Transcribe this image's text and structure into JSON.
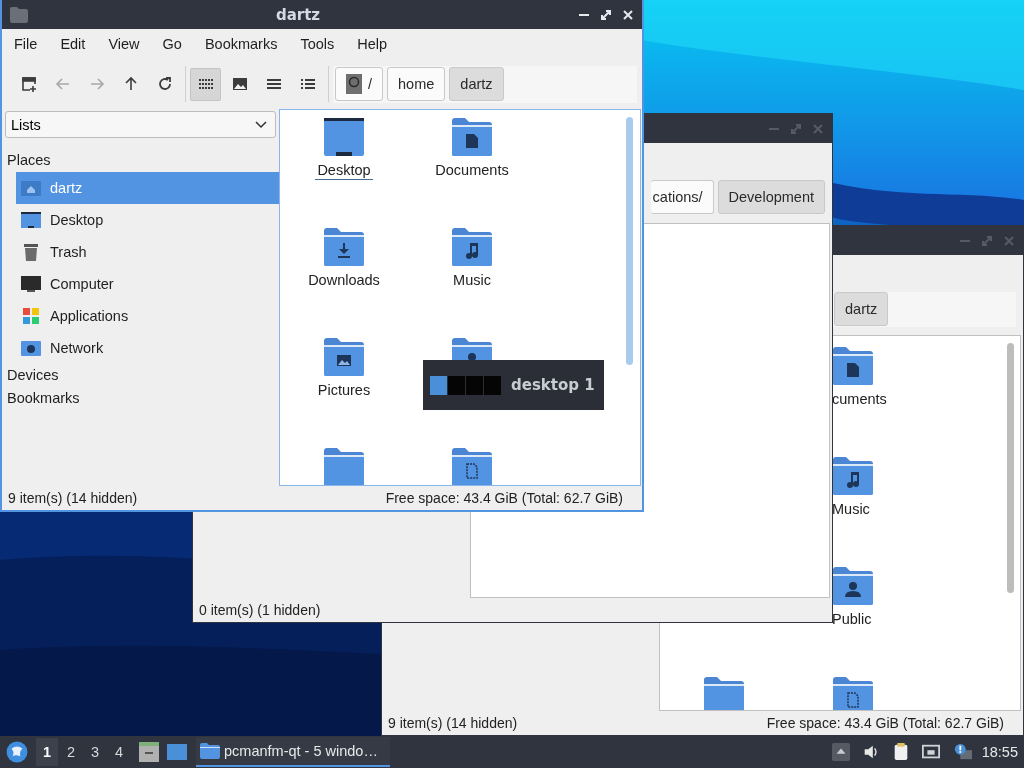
{
  "back_window": {
    "address": [
      {
        "label": "dartz",
        "selected": true
      }
    ],
    "files": [
      {
        "name": "cuments",
        "kind": "documents"
      },
      {
        "name": "Music",
        "kind": "music"
      },
      {
        "name": "Public",
        "kind": "public"
      },
      {
        "kind": "plain"
      },
      {
        "kind": "templates"
      }
    ],
    "status_left": "9 item(s) (14 hidden)",
    "status_right": "Free space: 43.4 GiB (Total: 62.7 GiB)"
  },
  "middle_window": {
    "address": [
      {
        "label": "cations/",
        "selected": false
      },
      {
        "label": "Development",
        "selected": true
      }
    ],
    "status_left": "0 item(s) (1 hidden)"
  },
  "front_window": {
    "title": "dartz",
    "menu": [
      "File",
      "Edit",
      "View",
      "Go",
      "Bookmarks",
      "Tools",
      "Help"
    ],
    "toolbar": [
      {
        "kind": "new-tab",
        "disabled": false
      },
      {
        "kind": "back",
        "disabled": true
      },
      {
        "kind": "forward",
        "disabled": true
      },
      {
        "kind": "up",
        "disabled": false
      },
      {
        "kind": "reload",
        "disabled": false
      }
    ],
    "view_modes": [
      {
        "kind": "icons",
        "selected": true
      },
      {
        "kind": "thumbnails",
        "selected": false
      },
      {
        "kind": "compact",
        "selected": false
      },
      {
        "kind": "details",
        "selected": false
      }
    ],
    "address": [
      {
        "label": "/",
        "kind": "root",
        "selected": false
      },
      {
        "label": "home",
        "kind": "dir",
        "selected": false
      },
      {
        "label": "dartz",
        "kind": "dir",
        "selected": true
      }
    ],
    "sidebar": {
      "dropdown": "Lists",
      "sections": [
        {
          "label": "Places",
          "children": [
            {
              "label": "dartz",
              "kind": "home",
              "selected": true
            },
            {
              "label": "Desktop",
              "kind": "desktop",
              "selected": false
            },
            {
              "label": "Trash",
              "kind": "trash",
              "selected": false
            },
            {
              "label": "Computer",
              "kind": "computer",
              "selected": false
            },
            {
              "label": "Applications",
              "kind": "applications",
              "selected": false
            },
            {
              "label": "Network",
              "kind": "network",
              "selected": false
            }
          ]
        },
        {
          "label": "Devices"
        },
        {
          "label": "Bookmarks"
        }
      ]
    },
    "files": [
      {
        "name": "Desktop",
        "kind": "desktop",
        "focused": true
      },
      {
        "name": "Documents",
        "kind": "documents",
        "focused": false
      },
      {
        "name": "Downloads",
        "kind": "downloads",
        "focused": false
      },
      {
        "name": "Music",
        "kind": "music",
        "focused": false
      },
      {
        "name": "Pictures",
        "kind": "pictures",
        "focused": false
      },
      {
        "kind": "public"
      },
      {
        "kind": "plain"
      },
      {
        "kind": "templates"
      }
    ],
    "status_left": "9 item(s) (14 hidden)",
    "status_right": "Free space: 43.4 GiB (Total: 62.7 GiB)"
  },
  "osd": {
    "label": "desktop 1",
    "desktops": [
      {
        "selected": true
      },
      {
        "selected": false
      },
      {
        "selected": false
      },
      {
        "selected": false
      }
    ]
  },
  "taskbar": {
    "desktops": [
      {
        "label": "1",
        "selected": true
      },
      {
        "label": "2",
        "selected": false
      },
      {
        "label": "3",
        "selected": false
      },
      {
        "label": "4",
        "selected": false
      }
    ],
    "launchers": [
      {
        "kind": "file-cabinet"
      },
      {
        "kind": "show-desktop"
      }
    ],
    "task": {
      "label": "pcmanfm-qt - 5 windo…",
      "selected": true
    },
    "tray": [
      {
        "kind": "arrow-up"
      },
      {
        "kind": "volume"
      },
      {
        "kind": "clipboard"
      },
      {
        "kind": "network"
      },
      {
        "kind": "notification"
      }
    ],
    "clock": "18:55"
  }
}
